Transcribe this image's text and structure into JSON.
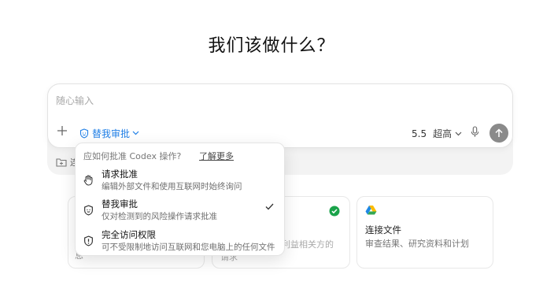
{
  "heading": "我们该做什么？",
  "composer": {
    "placeholder": "随心输入",
    "mode_label": "替我审批",
    "model_version": "5.5",
    "model_speed": "超高"
  },
  "under_row": {
    "label": "连"
  },
  "menu": {
    "header": "应如何批准 Codex 操作?",
    "learn_more": "了解更多",
    "items": [
      {
        "label": "请求批准",
        "desc": "编辑外部文件和使用互联网时始终询问",
        "icon": "hand-icon",
        "selected": false
      },
      {
        "label": "替我审批",
        "desc": "仅对检测到的风险操作请求批准",
        "icon": "shield-face-icon",
        "selected": true
      },
      {
        "label": "完全访问权限",
        "desc": "可不受限制地访问互联网和您电脑上的任何文件",
        "icon": "warning-shield-icon",
        "selected": false
      }
    ]
  },
  "cards": [
    {
      "tail": "息"
    },
    {
      "mid": "利益相关方的",
      "tail": "请求"
    },
    {
      "title": "连接文件",
      "desc": "审查结果、研究资料和计划"
    }
  ],
  "colors": {
    "accent": "#1e7ee6",
    "check_green": "#1aa34a",
    "send_bg": "#8a8a8a"
  }
}
